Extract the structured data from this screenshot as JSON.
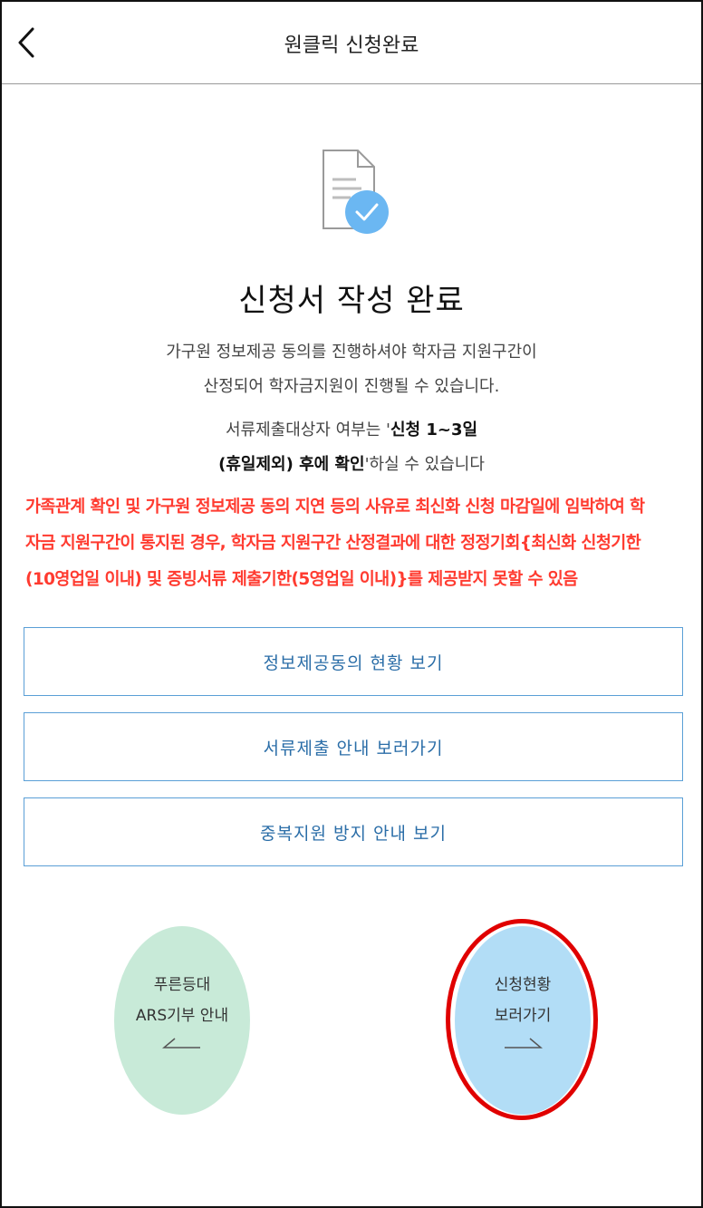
{
  "header": {
    "title": "원클릭 신청완료"
  },
  "main": {
    "title": "신청서 작성 완료",
    "desc_line1": "가구원 정보제공 동의를 진행하셔야 학자금 지원구간이",
    "desc_line2": "산정되어 학자금지원이 진행될 수 있습니다.",
    "notice_pre": "서류제출대상자 여부는 '",
    "notice_bold1": "신청 1~3일",
    "notice_bold2": "(휴일제외) 후에 확인",
    "notice_post": "'하실 수 있습니다",
    "warning_line1": "가족관계 확인 및 가구원 정보제공 동의 지연 등의 사유로 최신화 신청 마감일에 임박하여 학",
    "warning_line2": "자금 지원구간이 통지된 경우, 학자금 지원구간 산정결과에 대한 정정기회{최신화 신청기한",
    "warning_line3": "(10영업일 이내) 및 증빙서류 제출기한(5영업일 이내)}를 제공받지 못할 수 있음"
  },
  "buttons": {
    "consent_status": "정보제공동의 현황 보기",
    "document_guide": "서류제출 안내 보러가기",
    "duplicate_guide": "중복지원 방지 안내 보기"
  },
  "circles": {
    "left": {
      "line1": "푸른등대",
      "line2": "ARS기부 안내"
    },
    "right": {
      "line1": "신청현황",
      "line2": "보러가기"
    }
  },
  "colors": {
    "warning": "#ff3b30",
    "button_border": "#5a9fd6",
    "green_circle": "#c8ead8",
    "blue_circle": "#b2ddf6",
    "highlight": "#e00000",
    "check_badge": "#6bb7f2"
  },
  "icons": {
    "back": "chevron-left-icon",
    "document": "document-check-icon",
    "left_arrow": "arrow-left-icon",
    "right_arrow": "arrow-right-icon"
  }
}
